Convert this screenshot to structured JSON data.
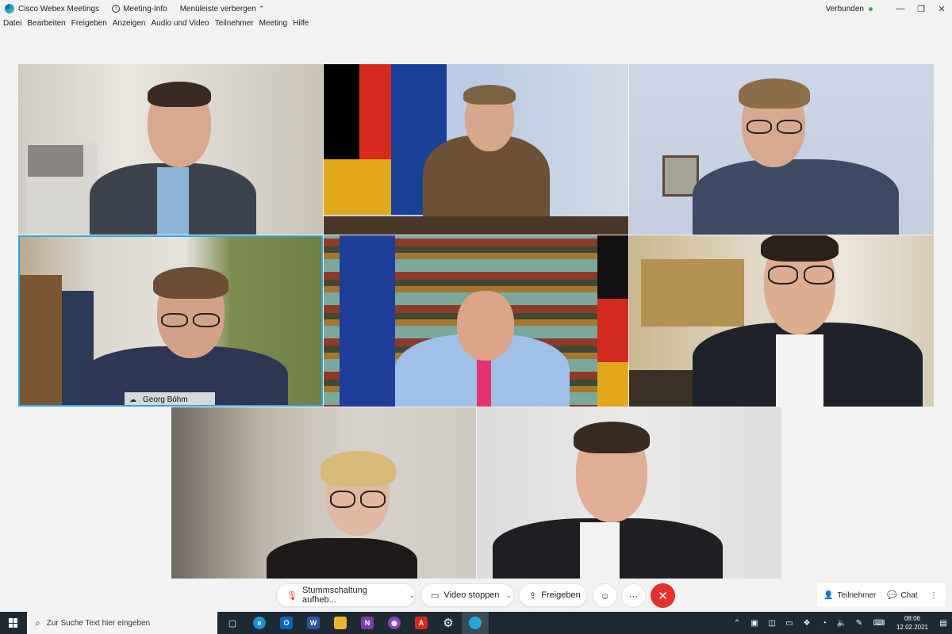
{
  "titlebar": {
    "app_name": "Cisco Webex Meetings",
    "meeting_info": "Meeting-Info",
    "hide_menu": "Menüleiste verbergen",
    "status": "Verbunden",
    "status_color": "#2fb34a"
  },
  "menu": [
    "Datei",
    "Bearbeiten",
    "Freigeben",
    "Anzeigen",
    "Audio und Video",
    "Teilnehmer",
    "Meeting",
    "Hilfe"
  ],
  "participants": {
    "active_name": "Georg Böhm"
  },
  "controls": {
    "mute_label": "Stummschaltung aufheb...",
    "video_label": "Video stoppen",
    "share_label": "Freigeben",
    "participants_label": "Teilnehmer",
    "chat_label": "Chat",
    "end_color": "#e3322c"
  },
  "taskbar": {
    "search_placeholder": "Zur Suche Text hier eingeben",
    "time": "08:06",
    "date": "12.02.2021"
  },
  "accent_color": "#2aa7e0"
}
